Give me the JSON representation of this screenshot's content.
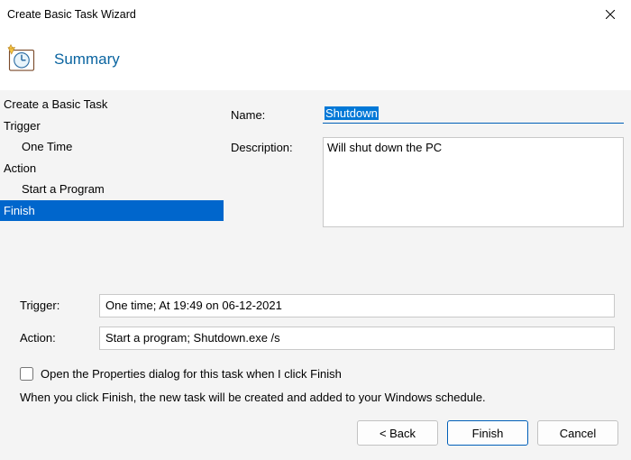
{
  "window": {
    "title": "Create Basic Task Wizard"
  },
  "header": {
    "title": "Summary"
  },
  "nav": {
    "items": [
      {
        "label": "Create a Basic Task",
        "indent": 0,
        "selected": false
      },
      {
        "label": "Trigger",
        "indent": 0,
        "selected": false
      },
      {
        "label": "One Time",
        "indent": 1,
        "selected": false
      },
      {
        "label": "Action",
        "indent": 0,
        "selected": false
      },
      {
        "label": "Start a Program",
        "indent": 1,
        "selected": false
      },
      {
        "label": "Finish",
        "indent": 0,
        "selected": true
      }
    ]
  },
  "form": {
    "name_label": "Name:",
    "name_value": "Shutdown",
    "desc_label": "Description:",
    "desc_value": "Will shut down the PC"
  },
  "summary": {
    "trigger_label": "Trigger:",
    "trigger_value": "One time; At 19:49 on 06-12-2021",
    "action_label": "Action:",
    "action_value": "Start a program; Shutdown.exe /s"
  },
  "options": {
    "open_props_label": "Open the Properties dialog for this task when I click Finish",
    "open_props_checked": false,
    "finish_hint": "When you click Finish, the new task will be created and added to your Windows schedule."
  },
  "buttons": {
    "back": "<  Back",
    "finish": "Finish",
    "cancel": "Cancel"
  }
}
